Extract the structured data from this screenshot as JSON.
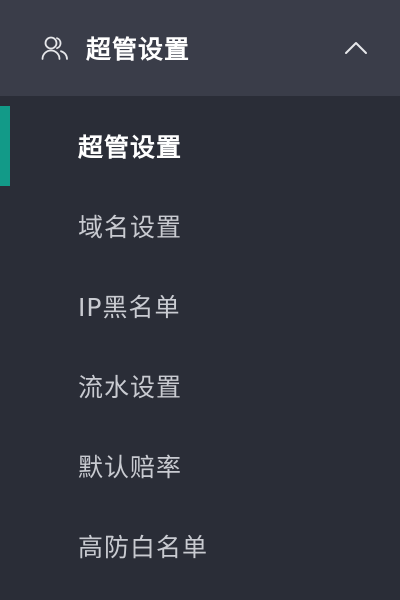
{
  "submenu": {
    "title": "超管设置",
    "icon": "users-icon",
    "toggle_icon": "chevron-up-icon",
    "expanded": true
  },
  "items": [
    {
      "label": "超管设置",
      "active": true
    },
    {
      "label": "域名设置",
      "active": false
    },
    {
      "label": "IP黑名单",
      "active": false
    },
    {
      "label": "流水设置",
      "active": false
    },
    {
      "label": "默认赔率",
      "active": false
    },
    {
      "label": "高防白名单",
      "active": false
    }
  ],
  "colors": {
    "menu_background": "#2a2d37",
    "header_background": "#3a3d49",
    "active_indicator": "#129a88",
    "active_text": "#ffffff",
    "inactive_text": "#c9cbd1"
  }
}
